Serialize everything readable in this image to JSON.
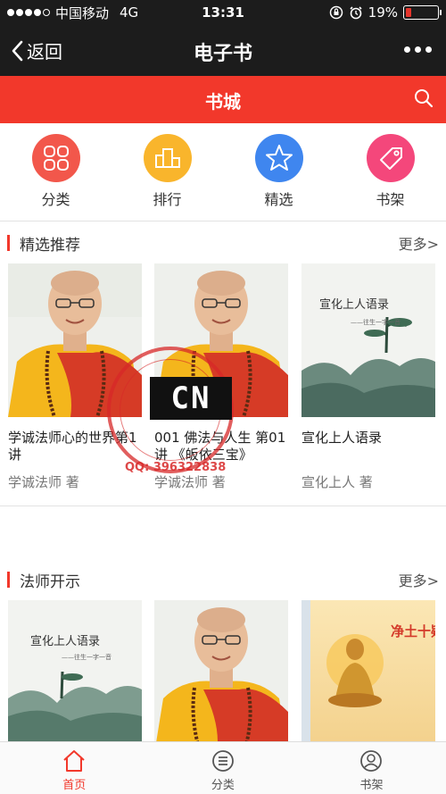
{
  "status_bar": {
    "carrier": "中国移动",
    "network": "4G",
    "time": "13:31",
    "battery": "19%",
    "battery_level": 0.19,
    "colors": {
      "battery_low": "#e5352c"
    }
  },
  "nav": {
    "back_label": "返回",
    "title": "电子书"
  },
  "store_header": {
    "title": "书城",
    "color": "#f2382b"
  },
  "quick_links": [
    {
      "label": "分类",
      "icon": "grid-icon",
      "color": "#f2574b"
    },
    {
      "label": "排行",
      "icon": "ranking-icon",
      "color": "#f9b52c"
    },
    {
      "label": "精选",
      "icon": "star-icon",
      "color": "#3f86ef"
    },
    {
      "label": "书架",
      "icon": "tag-icon",
      "color": "#f4477b"
    }
  ],
  "sections": [
    {
      "title": "精选推荐",
      "more_label": "更多>",
      "books": [
        {
          "title": "学诚法师心的世界第1讲",
          "author": "学诚法师 著",
          "cover": "monk-portrait"
        },
        {
          "title": "001 佛法与人生 第01讲 《皈依三宝》",
          "author": "学诚法师 著",
          "cover": "monk-portrait"
        },
        {
          "title": "宣化上人语录",
          "author": "宣化上人 著",
          "cover": "landscape-cover"
        }
      ]
    },
    {
      "title": "法师开示",
      "more_label": "更多>",
      "books": [
        {
          "title": "",
          "author": "",
          "cover": "landscape-cover"
        },
        {
          "title": "",
          "author": "",
          "cover": "monk-portrait"
        },
        {
          "title": "",
          "author": "",
          "cover": "buddha-cover"
        }
      ]
    }
  ],
  "covers_text": {
    "landscape_calligraphy": "宣化上人语录",
    "landscape_sub": "——往生一字一音",
    "buddha_title": "净土十疑论"
  },
  "watermark": {
    "logo_text": "CN",
    "qq": "QQ: 396322838"
  },
  "tabbar": [
    {
      "label": "首页",
      "icon": "home-icon",
      "active": true
    },
    {
      "label": "分类",
      "icon": "category-list-icon",
      "active": false
    },
    {
      "label": "书架",
      "icon": "user-icon",
      "active": false
    }
  ]
}
